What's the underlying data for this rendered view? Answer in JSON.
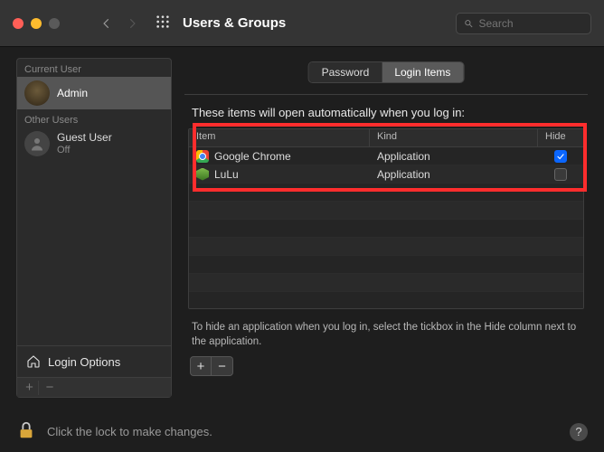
{
  "titlebar": {
    "title": "Users & Groups",
    "search_placeholder": "Search"
  },
  "sidebar": {
    "current_label": "Current User",
    "other_label": "Other Users",
    "current_user": {
      "name": "",
      "role": "Admin"
    },
    "other_users": [
      {
        "name": "Guest User",
        "status": "Off"
      }
    ],
    "login_options": "Login Options"
  },
  "tabs": {
    "password": "Password",
    "login_items": "Login Items"
  },
  "content": {
    "heading": "These items will open automatically when you log in:",
    "cols": {
      "item": "Item",
      "kind": "Kind",
      "hide": "Hide"
    },
    "rows": [
      {
        "name": "Google Chrome",
        "kind": "Application",
        "hide": true,
        "icon": "chrome"
      },
      {
        "name": "LuLu",
        "kind": "Application",
        "hide": false,
        "icon": "lulu"
      }
    ],
    "hint": "To hide an application when you log in, select the tickbox in the Hide column next to the application."
  },
  "footer": {
    "lock_text": "Click the lock to make changes."
  }
}
